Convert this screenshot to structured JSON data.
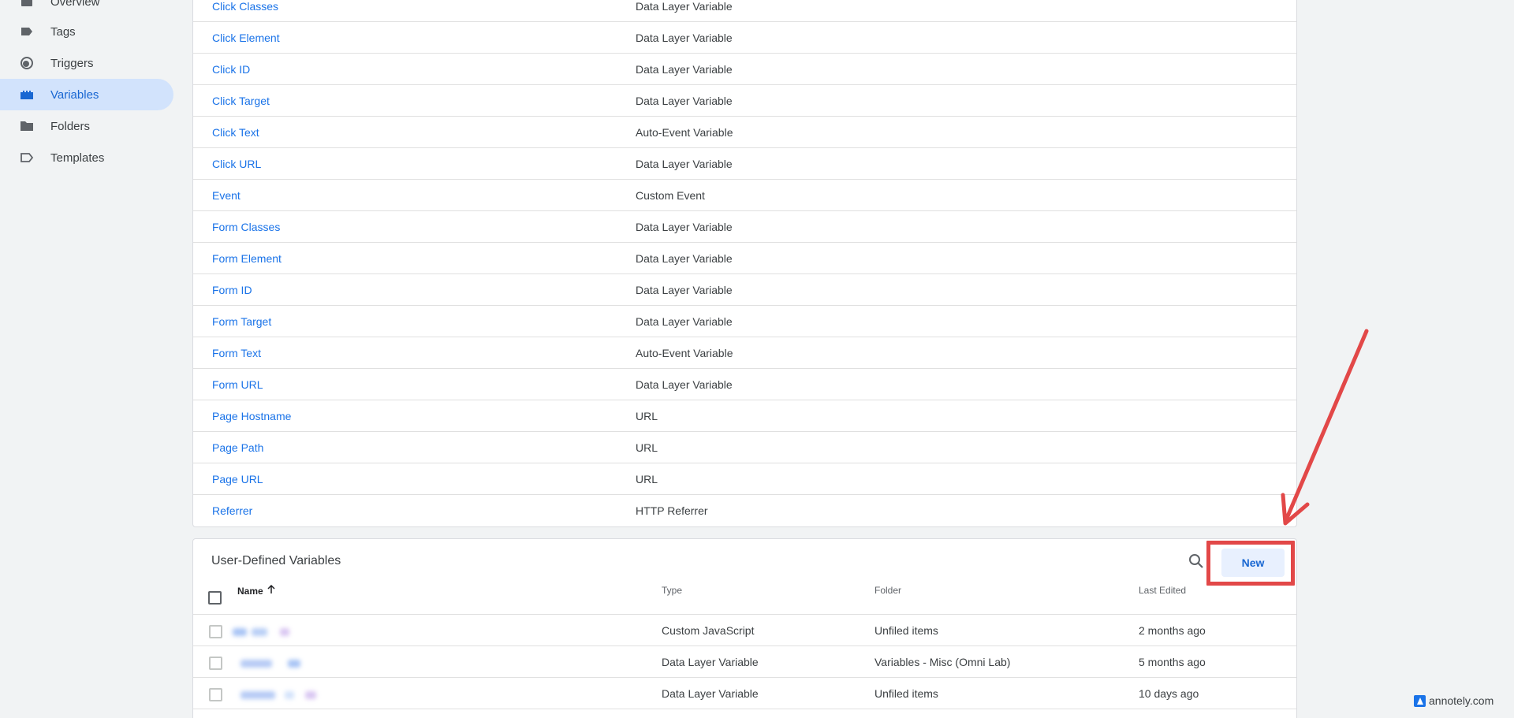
{
  "sidebar": {
    "items": [
      {
        "label": "Overview",
        "icon": "overview-icon",
        "active": false
      },
      {
        "label": "Tags",
        "icon": "tag-icon",
        "active": false
      },
      {
        "label": "Triggers",
        "icon": "trigger-icon",
        "active": false
      },
      {
        "label": "Variables",
        "icon": "variables-icon",
        "active": true
      },
      {
        "label": "Folders",
        "icon": "folder-icon",
        "active": false
      },
      {
        "label": "Templates",
        "icon": "template-icon",
        "active": false
      }
    ]
  },
  "builtin": {
    "rows": [
      {
        "name": "Click Classes",
        "type": "Data Layer Variable"
      },
      {
        "name": "Click Element",
        "type": "Data Layer Variable"
      },
      {
        "name": "Click ID",
        "type": "Data Layer Variable"
      },
      {
        "name": "Click Target",
        "type": "Data Layer Variable"
      },
      {
        "name": "Click Text",
        "type": "Auto-Event Variable"
      },
      {
        "name": "Click URL",
        "type": "Data Layer Variable"
      },
      {
        "name": "Event",
        "type": "Custom Event"
      },
      {
        "name": "Form Classes",
        "type": "Data Layer Variable"
      },
      {
        "name": "Form Element",
        "type": "Data Layer Variable"
      },
      {
        "name": "Form ID",
        "type": "Data Layer Variable"
      },
      {
        "name": "Form Target",
        "type": "Data Layer Variable"
      },
      {
        "name": "Form Text",
        "type": "Auto-Event Variable"
      },
      {
        "name": "Form URL",
        "type": "Data Layer Variable"
      },
      {
        "name": "Page Hostname",
        "type": "URL"
      },
      {
        "name": "Page Path",
        "type": "URL"
      },
      {
        "name": "Page URL",
        "type": "URL"
      },
      {
        "name": "Referrer",
        "type": "HTTP Referrer"
      }
    ]
  },
  "user_defined": {
    "title": "User-Defined Variables",
    "new_label": "New",
    "columns": {
      "name": "Name",
      "type": "Type",
      "folder": "Folder",
      "last_edited": "Last Edited"
    },
    "rows": [
      {
        "type": "Custom JavaScript",
        "folder": "Unfiled items",
        "last_edited": "2 months ago"
      },
      {
        "type": "Data Layer Variable",
        "folder": "Variables - Misc (Omni Lab)",
        "last_edited": "5 months ago"
      },
      {
        "type": "Data Layer Variable",
        "folder": "Unfiled items",
        "last_edited": "10 days ago"
      }
    ]
  },
  "watermark": "annotely.com",
  "colors": {
    "accent": "#1a73e8",
    "active_bg": "#d2e3fc",
    "annotation": "#e24848"
  }
}
